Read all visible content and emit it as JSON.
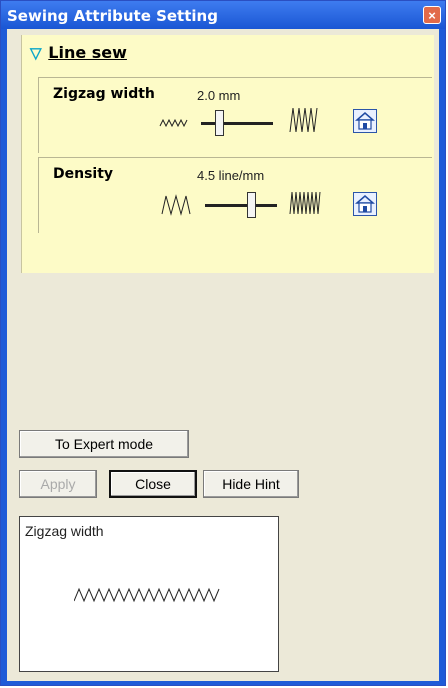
{
  "window": {
    "title": "Sewing Attribute Setting",
    "close_glyph": "×"
  },
  "section": {
    "title": "Line sew",
    "expand_glyph": "▽"
  },
  "settings": [
    {
      "label": "Zigzag width",
      "value": "2.0 mm"
    },
    {
      "label": "Density",
      "value": "4.5 line/mm"
    }
  ],
  "buttons": {
    "expert": "To Expert mode",
    "apply": "Apply",
    "close": "Close",
    "hide_hint": "Hide Hint"
  },
  "hint": {
    "title": "Zigzag width"
  },
  "icons": [
    "zigzag-narrow-icon",
    "zigzag-wide-icon",
    "density-low-icon",
    "density-high-icon",
    "home-icon"
  ]
}
